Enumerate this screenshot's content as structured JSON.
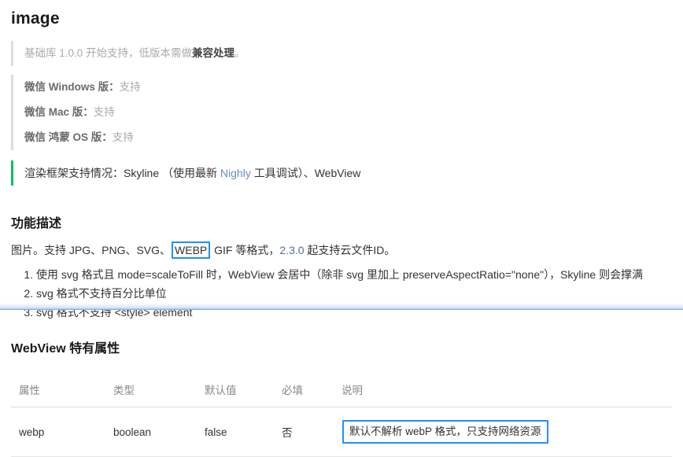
{
  "page_title": "image",
  "quotes": [
    {
      "accent": false,
      "parts": [
        {
          "type": "text",
          "text": "基础库 1.0.0 开始支持，低版本需做"
        },
        {
          "type": "strong",
          "text": "兼容处理"
        },
        {
          "type": "text",
          "text": "。"
        }
      ],
      "plain": "基础库 1.0.0 开始支持，低版本需做兼容处理。"
    },
    {
      "accent": false,
      "plain": "微信 Windows 版：支持",
      "label": "微信 Windows 版：",
      "value": "支持"
    },
    {
      "accent": false,
      "plain": "微信 Mac 版：支持",
      "label": "微信 Mac 版：",
      "value": "支持"
    },
    {
      "accent": false,
      "plain": "微信 鸿蒙 OS 版：支持",
      "label": "微信 鸿蒙 OS 版：",
      "value": "支持"
    }
  ],
  "render_support": {
    "prefix": "渲染框架支持情况：Skyline （使用最新 ",
    "link": "Nighly",
    "suffix": " 工具调试）、WebView",
    "plain": "渲染框架支持情况：Skyline （使用最新 Nighly 工具调试）、WebView"
  },
  "feature": {
    "heading": "功能描述",
    "desc_before": "图片。支持 JPG、PNG、SVG、",
    "desc_highlight": "WEBP",
    "desc_middle": " GIF 等格式，",
    "desc_link": "2.3.0",
    "desc_after": " 起支持云文件ID。",
    "notes": [
      "使用 svg 格式且 mode=scaleToFill 时，WebView 会居中（除非 svg 里加上 preserveAspectRatio=\"none\"），Skyline 则会撑满",
      "svg 格式不支持百分比单位",
      "svg 格式不支持 <style> element"
    ]
  },
  "webview": {
    "heading": "WebView 特有属性",
    "table": {
      "columns": [
        "属性",
        "类型",
        "默认值",
        "必填",
        "说明"
      ],
      "rows": [
        {
          "attr": "webp",
          "type": "boolean",
          "default": "false",
          "required": "否",
          "desc": "默认不解析 webP 格式，只支持网络资源",
          "desc_highlighted": true
        }
      ]
    }
  },
  "colors": {
    "accent_green": "#07c160",
    "link_blue": "#576b95",
    "highlight_border": "#1e90ff",
    "quote_border": "#dddddd",
    "text": "#333333",
    "muted": "#aaaaaa"
  }
}
